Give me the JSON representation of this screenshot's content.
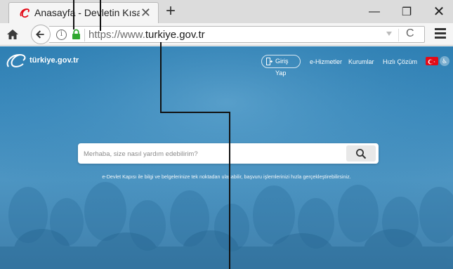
{
  "browser": {
    "tab": {
      "title": "Anasayfa - Devletin Kısayo...",
      "favicon": "edevlet-favicon-icon",
      "close_glyph": "✕"
    },
    "new_tab_glyph": "+",
    "window_controls": {
      "minimize_glyph": "—",
      "maximize_glyph": "❐",
      "close_glyph": "✕"
    },
    "nav": {
      "home_icon": "home-icon",
      "back_icon": "back-arrow-icon",
      "info_glyph": "i",
      "lock_icon": "padlock-icon",
      "url_prefix": "https://www.",
      "url_host": "turkiye.gov.tr",
      "reload_glyph": "C",
      "menu_icon": "hamburger-icon"
    }
  },
  "site": {
    "logo_text": "türkiye.gov.tr",
    "login_label": "Giriş Yap",
    "nav_links": [
      "e-Hizmetler",
      "Kurumlar",
      "Hızlı Çözüm"
    ],
    "a11y_glyph": "♿",
    "search": {
      "placeholder": "Merhaba, size nasıl yardım edebilirim?",
      "button_icon": "search-icon"
    },
    "tagline": "e-Devlet Kapısı ile bilgi ve belgelerinize tek noktadan ulaşabilir, başvuru işlemlerinizi hızla gerçekleştirebilirsiniz."
  },
  "colors": {
    "accent_red": "#e30a17",
    "page_blue": "#3d8bbd",
    "lock_green": "#2fa82f"
  }
}
